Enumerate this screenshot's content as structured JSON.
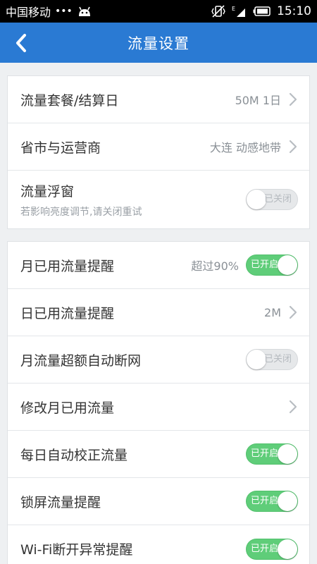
{
  "status_bar": {
    "carrier": "中国移动",
    "dots": "•••",
    "network": "E",
    "time": "15:10"
  },
  "header": {
    "title": "流量设置",
    "back_icon": "chevron-left-icon"
  },
  "section1": {
    "rows": [
      {
        "label": "流量套餐/结算日",
        "value": "50M 1日"
      },
      {
        "label": "省市与运营商",
        "value": "大连 动感地带"
      },
      {
        "label": "流量浮窗",
        "sublabel": "若影响亮度调节,请关闭重试",
        "toggle_label": "已关闭",
        "toggle_on": false
      }
    ]
  },
  "section2": {
    "rows": [
      {
        "label": "月已用流量提醒",
        "value": "超过90%",
        "toggle_label": "已开启",
        "toggle_on": true
      },
      {
        "label": "日已用流量提醒",
        "value": "2M"
      },
      {
        "label": "月流量超额自动断网",
        "toggle_label": "已关闭",
        "toggle_on": false
      },
      {
        "label": "修改月已用流量"
      },
      {
        "label": "每日自动校正流量",
        "toggle_label": "已开启",
        "toggle_on": true
      },
      {
        "label": "锁屏流量提醒",
        "toggle_label": "已开启",
        "toggle_on": true
      },
      {
        "label": "Wi-Fi断开异常提醒",
        "toggle_label": "已开启",
        "toggle_on": true
      }
    ]
  },
  "colors": {
    "header_bg": "#2a7ad3",
    "toggle_on": "#5fcd79",
    "toggle_off": "#e6e8ea"
  }
}
